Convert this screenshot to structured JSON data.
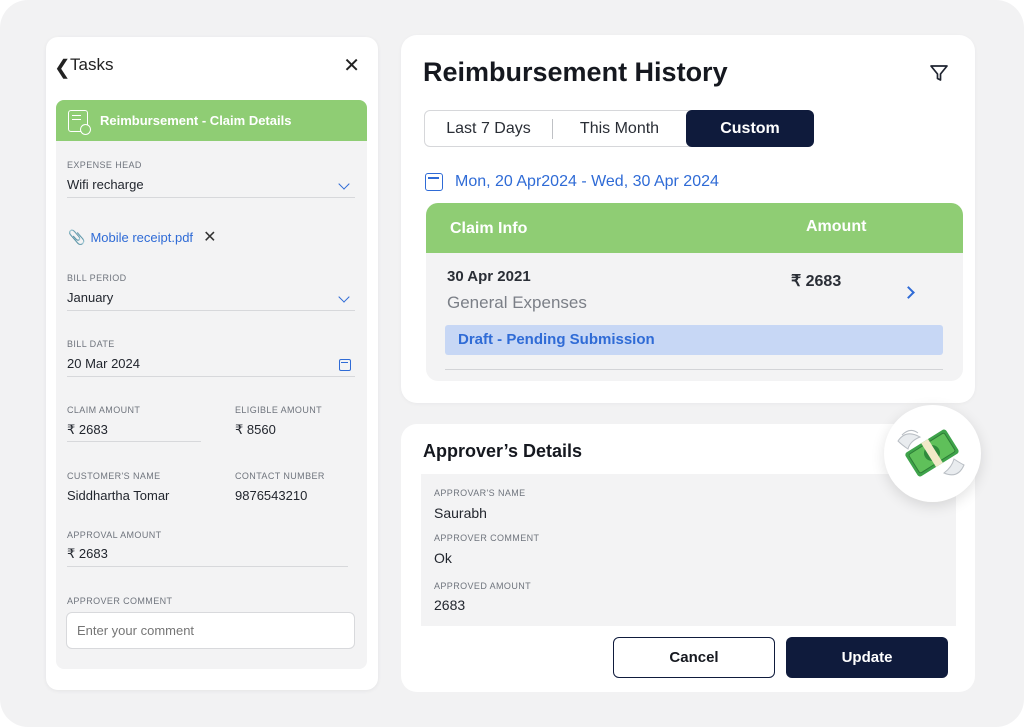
{
  "tasks_panel": {
    "back_icon": "chevron-left-icon",
    "title": "Tasks",
    "close_icon": "close-icon",
    "card": {
      "title": "Reimbursement -  Claim Details",
      "icon": "receipt-icon",
      "expense_head": {
        "label": "EXPENSE HEAD",
        "value": "Wifi recharge"
      },
      "attachment": {
        "name": "Mobile receipt.pdf"
      },
      "bill_period": {
        "label": "BILL PERIOD",
        "value": "January"
      },
      "bill_date": {
        "label": "BILL DATE",
        "value": "20 Mar 2024"
      },
      "claim_amount": {
        "label": "CLAIM AMOUNT",
        "value": "₹ 2683"
      },
      "eligible_amount": {
        "label": "ELIGIBLE AMOUNT",
        "value": "₹ 8560"
      },
      "customer_name": {
        "label": "CUSTOMER'S NAME",
        "value": "Siddhartha Tomar"
      },
      "contact_number": {
        "label": "CONTACT NUMBER",
        "value": "9876543210"
      },
      "approval_amount": {
        "label": "APPROVAL AMOUNT",
        "value": "₹ 2683"
      },
      "approver_comment": {
        "label": "APPROVER COMMENT",
        "placeholder": "Enter your comment"
      }
    }
  },
  "history": {
    "title": "Reimbursement History",
    "filter_icon": "filter-icon",
    "tabs": [
      {
        "label": "Last 7 Days",
        "active": false
      },
      {
        "label": "This Month",
        "active": false
      },
      {
        "label": "Custom",
        "active": true
      }
    ],
    "date_range": "Mon, 20 Apr2024 - Wed, 30 Apr 2024",
    "table": {
      "headers": [
        "Claim Info",
        "Amount"
      ],
      "rows": [
        {
          "date": "30 Apr 2021",
          "category": "General Expenses",
          "amount": "₹ 2683",
          "status": "Draft - Pending Submission"
        }
      ]
    }
  },
  "approver": {
    "title": "Approver’s Details",
    "name": {
      "label": "APPROVAR'S NAME",
      "value": "Saurabh"
    },
    "comment": {
      "label": "APPROVER COMMENT",
      "value": "Ok"
    },
    "amount": {
      "label": "APPROVED AMOUNT",
      "value": "2683"
    },
    "cancel_label": "Cancel",
    "update_label": "Update"
  },
  "colors": {
    "accent_green": "#8fcd74",
    "navy": "#0f1b3c",
    "link_blue": "#2f6bd6",
    "badge_bg": "#c7d7f5"
  }
}
